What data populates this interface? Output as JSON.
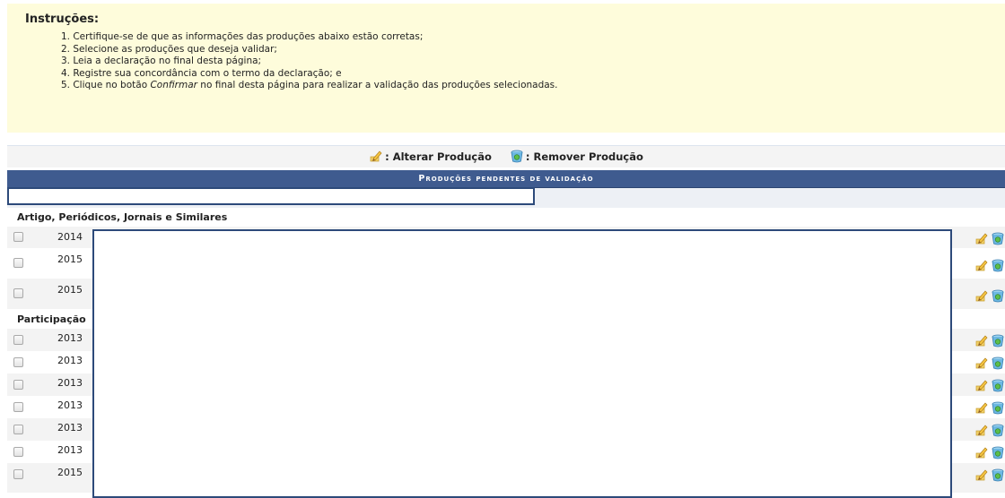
{
  "instructions": {
    "title": "Instruções:",
    "steps": [
      "1. Certifique-se de que as informações das produções abaixo estão corretas;",
      "2. Selecione as produções que deseja validar;",
      "3. Leia a declaração no final desta página;",
      "4. Registre sua concordância com o termo da declaração; e",
      "5. Clique no botão ",
      "Confirmar",
      " no final desta página para realizar a validação das produções selecionadas."
    ]
  },
  "legend": {
    "edit_label": ": Alterar Produção",
    "remove_label": ": Remover Produção"
  },
  "table": {
    "caption": "Produções pendentes de validação",
    "groups": [
      {
        "name": "Artigo, Periódicos, Jornais e Similares"
      },
      {
        "name": "Participação"
      }
    ],
    "rows": [
      {
        "year": "2014"
      },
      {
        "year": "2015"
      },
      {
        "year": "2015"
      },
      {
        "year": "2013"
      },
      {
        "year": "2013"
      },
      {
        "year": "2013"
      },
      {
        "year": "2013"
      },
      {
        "year": "2013"
      },
      {
        "year": "2013"
      },
      {
        "year": "2015"
      }
    ]
  },
  "colors": {
    "instructions_bg": "#fefcdb",
    "caption_bg": "#3f5b8f",
    "redaction_border": "#2d4a7a"
  },
  "icons": [
    "pencil-edit-icon",
    "trash-remove-icon"
  ]
}
